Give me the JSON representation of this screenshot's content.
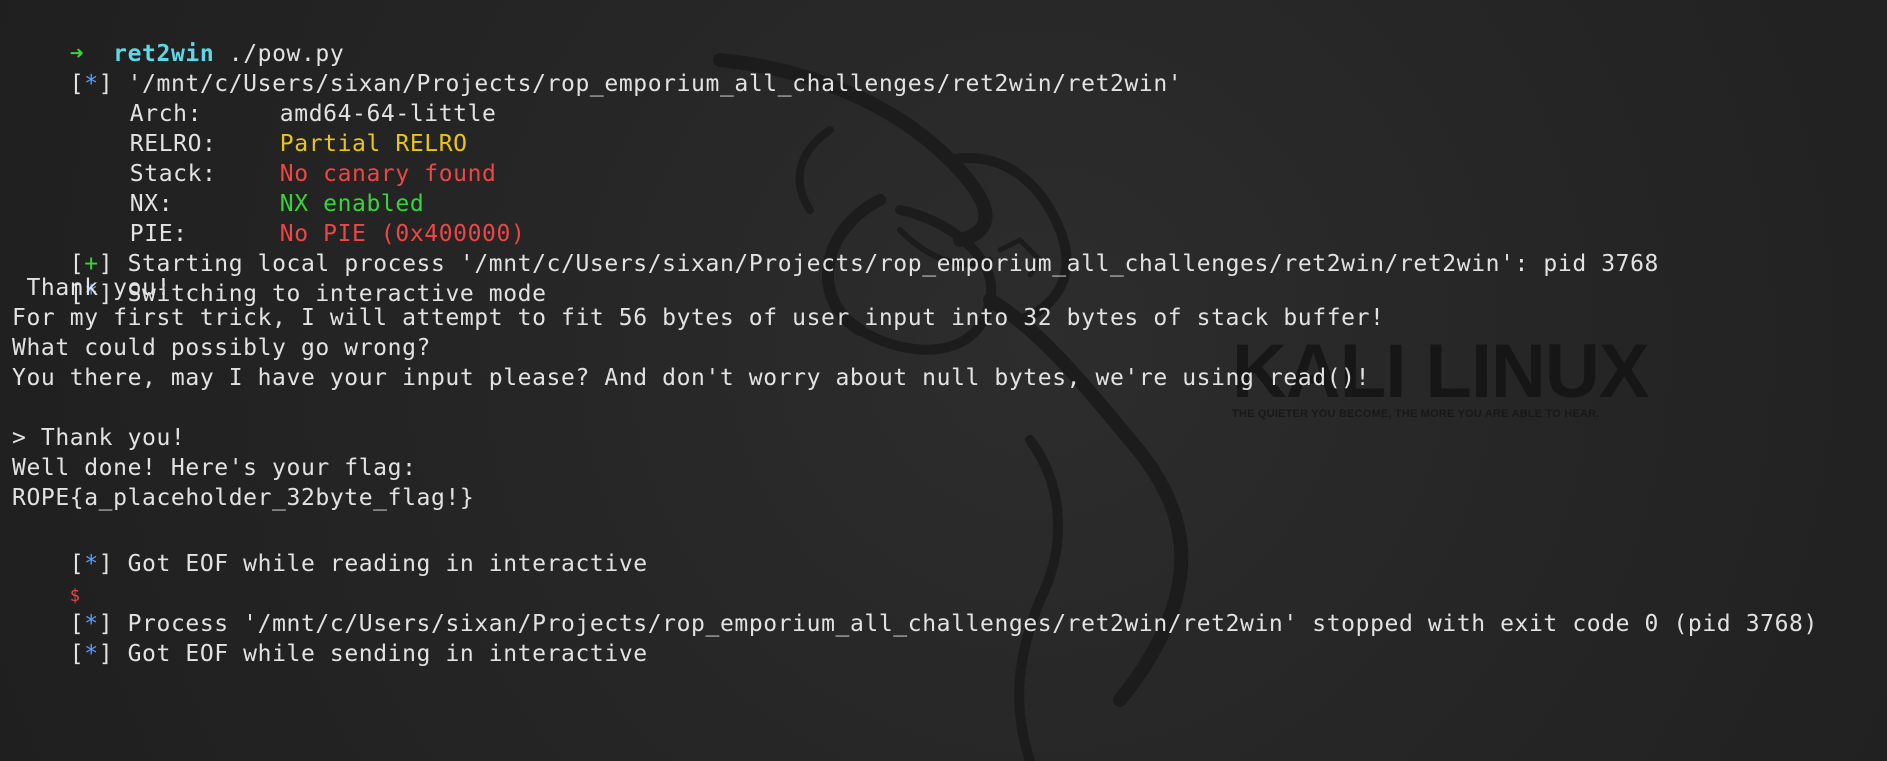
{
  "prompt": {
    "arrow": "➜",
    "directory": "ret2win",
    "command": "./pow.py"
  },
  "checksec": {
    "path_line": "'/mnt/c/Users/sixan/Projects/rop_emporium_all_challenges/ret2win/ret2win'",
    "rows": [
      {
        "key": "Arch:",
        "value": "amd64-64-little",
        "color": "#e2e2e2"
      },
      {
        "key": "RELRO:",
        "value": "Partial RELRO",
        "color": "#e8c51a"
      },
      {
        "key": "Stack:",
        "value": "No canary found",
        "color": "#ef4545"
      },
      {
        "key": "NX:",
        "value": "NX enabled",
        "color": "#3ad43a"
      },
      {
        "key": "PIE:",
        "value": "No PIE (0x400000)",
        "color": "#ef4545"
      }
    ]
  },
  "output": {
    "starting": "Starting local process '/mnt/c/Users/sixan/Projects/rop_emporium_all_challenges/ret2win/ret2win': pid 3768",
    "switching": "Switching to interactive mode",
    "thank1": " Thank you!",
    "trick": "For my first trick, I will attempt to fit 56 bytes of user input into 32 bytes of stack buffer!",
    "wrong": "What could possibly go wrong?",
    "input_prompt": "You there, may I have your input please? And don't worry about null bytes, we're using read()!",
    "thank2": "> Thank you!",
    "well_done": "Well done! Here's your flag:",
    "flag": "ROPE{a_placeholder_32byte_flag!}",
    "eof_reading": "Got EOF while reading in interactive",
    "dollar": "$",
    "stopped": "Process '/mnt/c/Users/sixan/Projects/rop_emporium_all_challenges/ret2win/ret2win' stopped with exit code 0 (pid 3768)",
    "eof_sending": "Got EOF while sending in interactive"
  },
  "markers": {
    "info": "*",
    "success": "+"
  },
  "watermark": {
    "title": "KALI LINUX",
    "tagline": "THE QUIETER YOU BECOME, THE MORE YOU ARE ABLE TO HEAR."
  },
  "colors": {
    "background": "#262626",
    "text": "#e2e2e2",
    "green": "#3ad43a",
    "yellow": "#e8c51a",
    "red": "#ef4545",
    "cyan": "#5ed8e8",
    "info_star": "#5aa0ff"
  }
}
